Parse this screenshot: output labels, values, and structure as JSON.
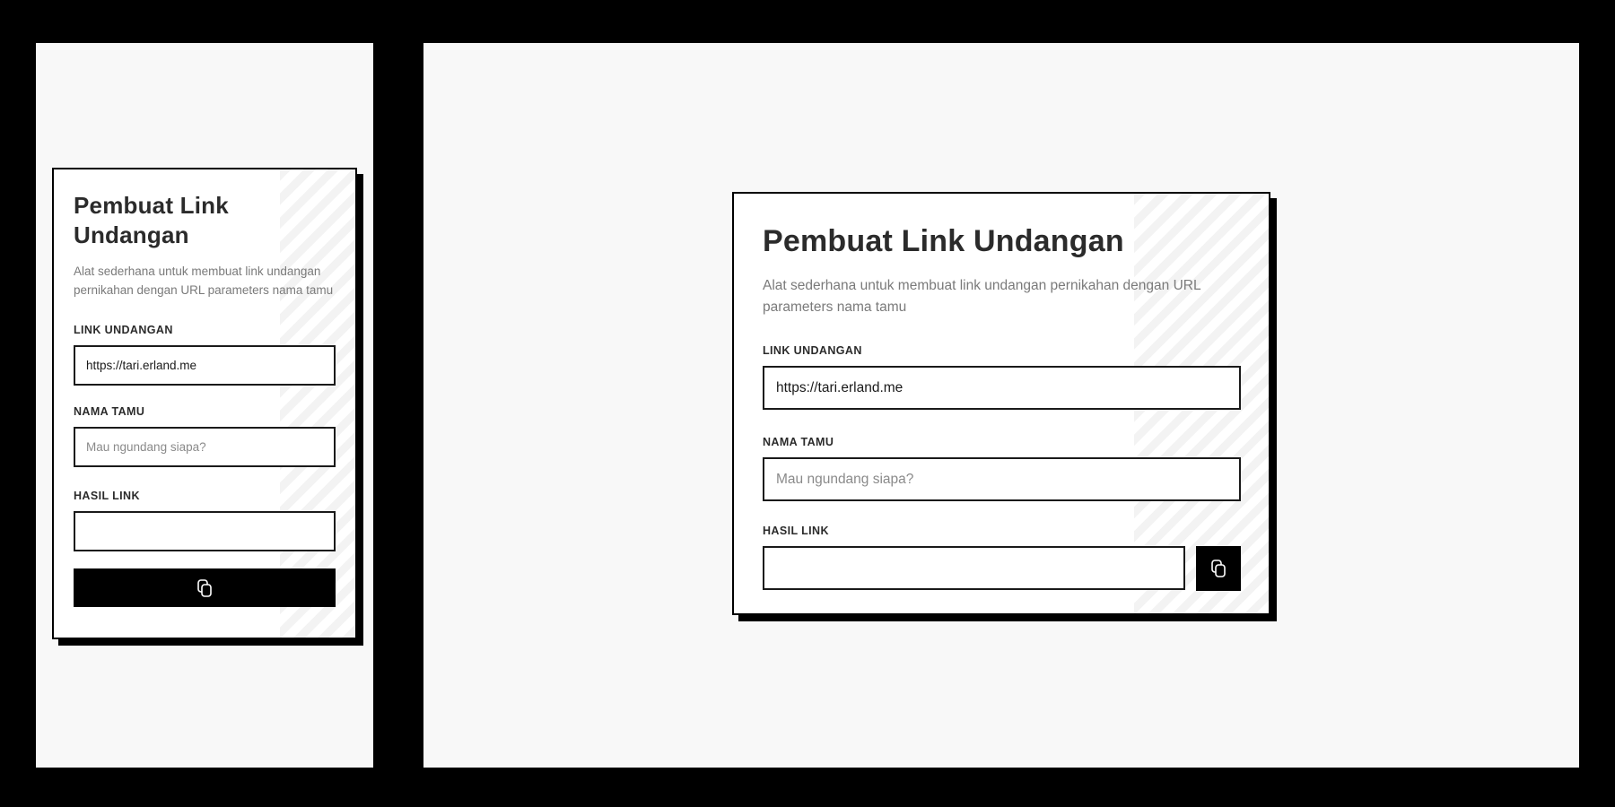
{
  "app": {
    "title": "Pembuat Link Undangan",
    "description": "Alat sederhana untuk membuat link undangan pernikahan dengan URL parameters nama tamu"
  },
  "form": {
    "link_label": "LINK UNDANGAN",
    "link_value": "https://tari.erland.me",
    "guest_label": "NAMA TAMU",
    "guest_placeholder": "Mau ngundang siapa?",
    "guest_value": "",
    "result_label": "HASIL LINK",
    "result_value": "",
    "copy_button_icon": "copy-icon"
  },
  "colors": {
    "accent": "#000000",
    "background": "#f8f8f8",
    "card": "#ffffff"
  }
}
